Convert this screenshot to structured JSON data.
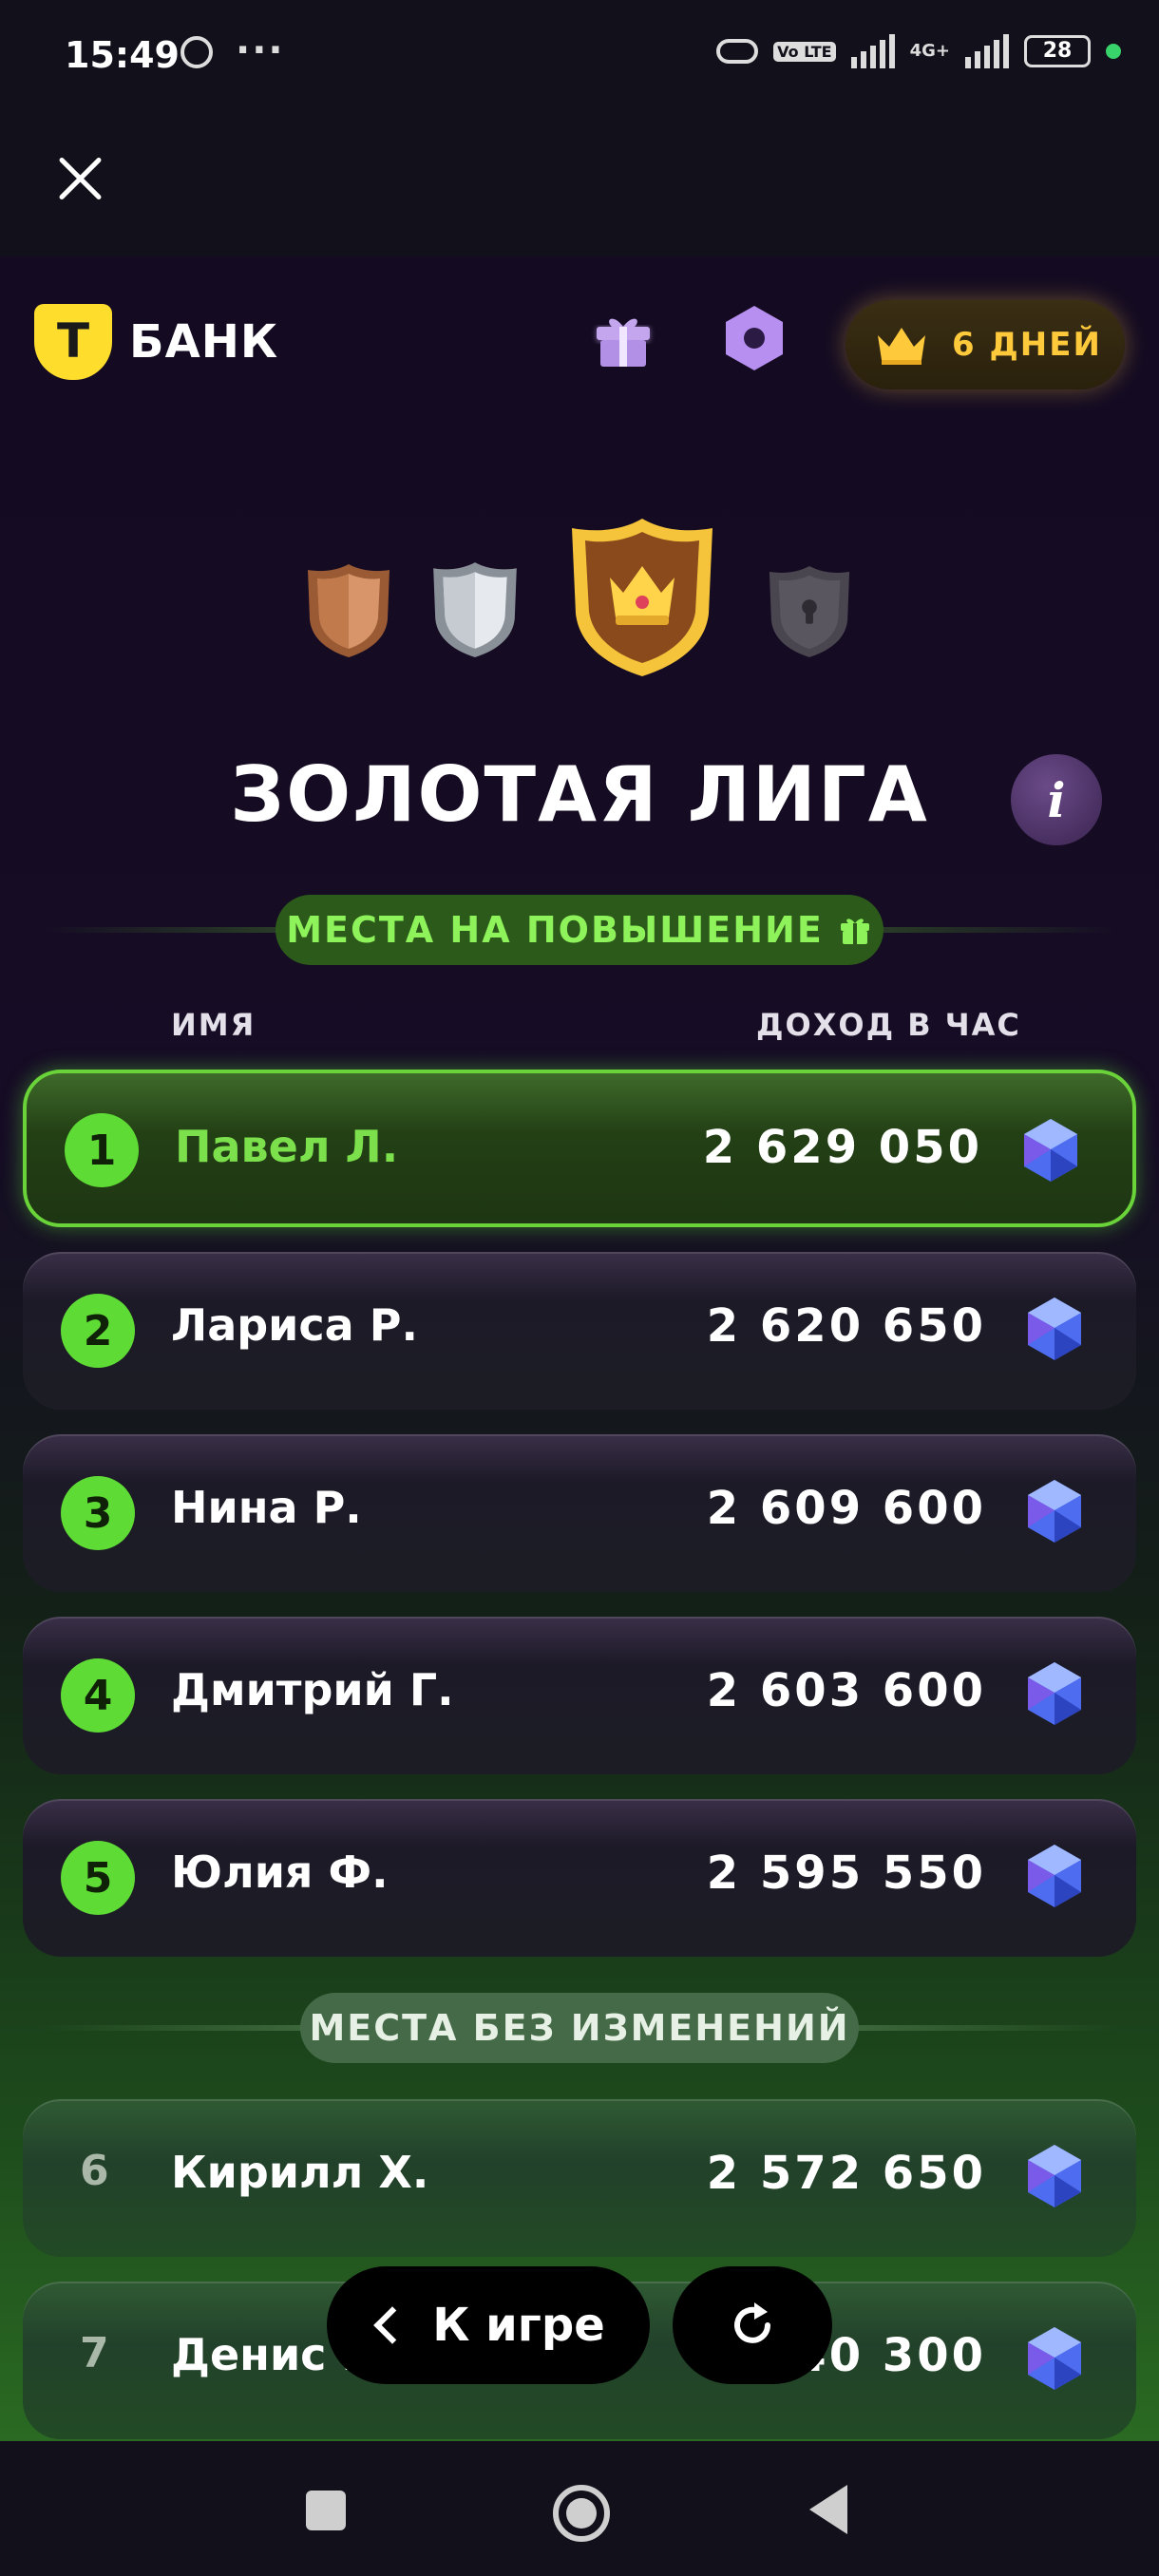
{
  "status_bar": {
    "time": "15:49",
    "dots": "···",
    "volte": "Vo LTE",
    "net_type": "4G+",
    "battery": "28"
  },
  "header": {
    "logo_letter": "T",
    "logo_text": "БАНК",
    "premium_label": "6 ДНЕЙ"
  },
  "league": {
    "title": "ЗОЛОТАЯ ЛИГА",
    "info_label": "i"
  },
  "sections": {
    "promotion": "МЕСТА НА ПОВЫШЕНИЕ",
    "unchanged": "МЕСТА БЕЗ ИЗМЕНЕНИЙ"
  },
  "columns": {
    "name": "ИМЯ",
    "income": "ДОХОД В ЧАС"
  },
  "leaderboard": [
    {
      "rank": "1",
      "name": "Павел Л.",
      "income": "2 629 050"
    },
    {
      "rank": "2",
      "name": "Лариса Р.",
      "income": "2 620 650"
    },
    {
      "rank": "3",
      "name": "Нина Р.",
      "income": "2 609 600"
    },
    {
      "rank": "4",
      "name": "Дмитрий Г.",
      "income": "2 603 600"
    },
    {
      "rank": "5",
      "name": "Юлия Ф.",
      "income": "2 595 550"
    },
    {
      "rank": "6",
      "name": "Кирилл Х.",
      "income": "2 572 650"
    },
    {
      "rank": "7",
      "name": "Денис Б",
      "income": "40 300"
    }
  ],
  "buttons": {
    "back_to_game": "К игре"
  },
  "colors": {
    "accent_green": "#5fdb36",
    "gold": "#ffc93c",
    "brand_yellow": "#ffdd2d"
  }
}
